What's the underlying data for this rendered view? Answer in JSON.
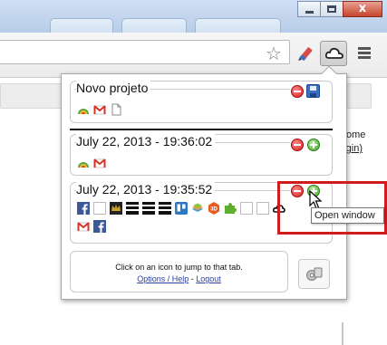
{
  "window": {
    "minimize_icon": "minimize-icon",
    "maximize_icon": "maximize-icon",
    "close_icon": "close-icon",
    "close_glyph": "x"
  },
  "toolbar": {
    "bookmark_icon": "star-icon",
    "bookmark_glyph": "☆",
    "extension_icon": "pencil-icon",
    "active_extension_icon": "cloud-icon",
    "menu_icon": "hamburger-menu-icon"
  },
  "background_page": {
    "text_fragment": "ome",
    "link_fragment": "gin)",
    "link_prefix": "("
  },
  "popup": {
    "sessions": [
      {
        "title": "Novo projeto",
        "actions": [
          "remove-icon",
          "save-icon"
        ],
        "tab_icons": [
          "chrome-icon",
          "gmail-icon",
          "blank-page-icon"
        ]
      },
      {
        "title": "July 22, 2013 - 19:36:02",
        "actions": [
          "remove-icon",
          "open-window-icon"
        ],
        "tab_icons": [
          "chrome-icon",
          "gmail-icon"
        ]
      },
      {
        "title": "July 22, 2013 - 19:35:52",
        "actions": [
          "remove-icon",
          "open-window-icon"
        ],
        "tab_icons_row1": [
          "facebook-icon",
          "blank-icon",
          "crown-icon",
          "black-bars-icon",
          "black-bars-icon",
          "black-bars-icon",
          "trello-icon",
          "layers-icon",
          "orange-badge-icon",
          "puzzle-icon",
          "blank-icon",
          "blank-icon",
          "cloud-icon"
        ],
        "tab_icons_row2": [
          "gmail-icon",
          "facebook-icon"
        ]
      }
    ],
    "footer": {
      "instruction": "Click on an icon to jump to that tab.",
      "options_link": "Options / Help",
      "separator": "-",
      "logout_link": "Logout"
    },
    "preferences_icon": "gears-icon"
  },
  "tooltip": {
    "text": "Open window"
  },
  "colors": {
    "remove": "#d21f1f",
    "add": "#3fa326",
    "highlight": "#d11c1c",
    "link": "#2a3fa0"
  }
}
